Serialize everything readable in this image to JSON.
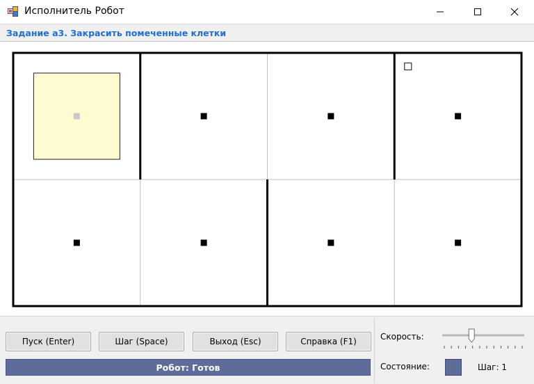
{
  "window": {
    "title": "Исполнитель Робот",
    "icon": "robot-app-icon",
    "controls": [
      "minimize-icon",
      "maximize-icon",
      "close-icon"
    ]
  },
  "task": {
    "title": "Задание а3. Закрасить помеченные клетки"
  },
  "field": {
    "rows": 2,
    "cols": 4,
    "cells": [
      {
        "row": 0,
        "col": 0,
        "marked": true,
        "painted": false,
        "robot": true
      },
      {
        "row": 0,
        "col": 1,
        "marked": true,
        "painted": false,
        "robot": false
      },
      {
        "row": 0,
        "col": 2,
        "marked": true,
        "painted": false,
        "robot": false
      },
      {
        "row": 0,
        "col": 3,
        "marked": true,
        "painted": false,
        "robot": false,
        "finish": true
      },
      {
        "row": 1,
        "col": 0,
        "marked": true,
        "painted": false,
        "robot": false
      },
      {
        "row": 1,
        "col": 1,
        "marked": true,
        "painted": false,
        "robot": false
      },
      {
        "row": 1,
        "col": 2,
        "marked": true,
        "painted": false,
        "robot": false
      },
      {
        "row": 1,
        "col": 3,
        "marked": true,
        "painted": false,
        "robot": false
      }
    ],
    "walls": {
      "vertical": [
        {
          "after_col": 1,
          "row": 0
        },
        {
          "after_col": 3,
          "row": 0
        },
        {
          "after_col": 2,
          "row": 1
        }
      ]
    },
    "colors": {
      "robot_fill": "#fffbd0",
      "marker": "#000000",
      "robot_marker": "#c8c8c8",
      "grid": "#c0c0c0",
      "wall": "#000000"
    }
  },
  "buttons": {
    "run": "Пуск (Enter)",
    "step": "Шаг (Space)",
    "exit": "Выход (Esc)",
    "help": "Справка (F1)"
  },
  "status": {
    "text": "Робот: Готов",
    "color": "#5f6b98"
  },
  "controls": {
    "speed_label": "Скорость:",
    "speed_value": 0.35,
    "state_label": "Состояние:",
    "state_color": "#5f6b98",
    "step_text": "Шаг: 1"
  }
}
